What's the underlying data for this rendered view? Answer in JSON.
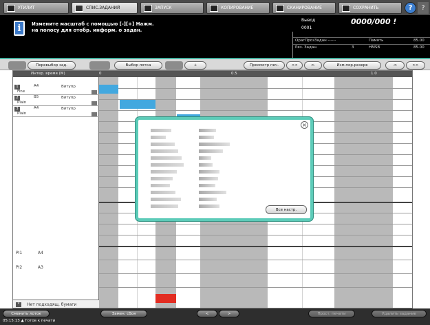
{
  "tabs": [
    {
      "label": "УТИЛИТ",
      "active": false
    },
    {
      "label": "СПИС.ЗАДАНИЙ",
      "active": true
    },
    {
      "label": "ЗАПУСК",
      "active": false
    },
    {
      "label": "КОПИРОВАНИЕ",
      "active": false
    },
    {
      "label": "СКАНИРОВАНИЕ",
      "active": false
    },
    {
      "label": "СОХРАНИТЬ",
      "active": false
    }
  ],
  "help_label": "?",
  "extra_label": "?",
  "message": {
    "line1": "Измените масштаб с помощью [-][+] Нажм.",
    "line2": "на полосу для отобр. информ. о задан."
  },
  "status": {
    "counter_label": "Вывод",
    "counter_value": "0000/000 !",
    "job_count": "0001",
    "row1_left": "ОрагПрозЗадан ------",
    "row1_mid": "Память",
    "row1_right": "85.00",
    "row2_left": "Рез. Задан.",
    "row2_num": "3",
    "row2_mid": "HMSB",
    "row2_right": "85.00"
  },
  "toolbar": {
    "reselect_job": "Перевыбор зад.",
    "select_tray": "Выбор лотка",
    "plus": "+",
    "print_preview": "Просмотр печ.",
    "prev_all": "<<",
    "prev": "<-",
    "change_reserve": "Изм.пор.резерв",
    "next": "->",
    "next_all": ">>"
  },
  "timeline": {
    "header_label": "Интер. время (М)",
    "tick_0": "0",
    "tick_05": "0.5",
    "tick_1": "1.0"
  },
  "jobs": [
    {
      "num": "1",
      "paper": "A4",
      "size_note": "Витупр",
      "type": "Fine"
    },
    {
      "num": "2",
      "paper": "B5",
      "size_note": "Витупр",
      "type": "Plain"
    },
    {
      "num": "3",
      "paper": "A4",
      "size_note": "Витупр",
      "type": "Plain"
    }
  ],
  "trays": [
    {
      "name": "PI1",
      "size": "A4"
    },
    {
      "name": "PI2",
      "size": "A3"
    }
  ],
  "bottom_label": "Нет подходящ. бумаги",
  "popup": {
    "close_label": "×",
    "all_settings": "Все настр."
  },
  "bottom_buttons": {
    "change_tray": "Сменить лоток",
    "change_paper": "Замен. сбоя",
    "left_arrow": "<",
    "right_arrow": ">",
    "stop_print": "Прост. печати",
    "delete_job": "Удалить задание"
  },
  "clock": "05:15:13 ▲ Готов к печати"
}
